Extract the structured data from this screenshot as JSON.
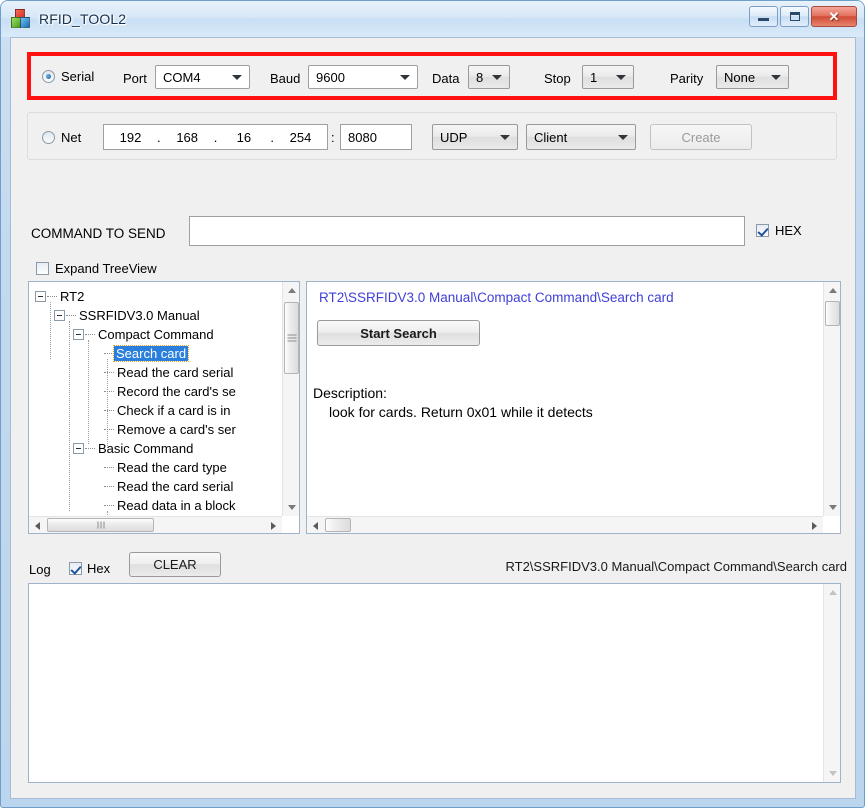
{
  "window": {
    "title": "RFID_TOOL2",
    "icon": "app-cubes-icon",
    "buttons": {
      "minimize": "minimize",
      "maximize": "maximize",
      "close": "close"
    }
  },
  "annotation": {
    "color": "#ff1111",
    "target": "serial-settings-row"
  },
  "serial": {
    "radio_label": "Serial",
    "radio_selected": true,
    "port_label": "Port",
    "port_value": "COM4",
    "baud_label": "Baud",
    "baud_value": "9600",
    "data_label": "Data",
    "data_value": "8",
    "stop_label": "Stop",
    "stop_value": "1",
    "parity_label": "Parity",
    "parity_value": "None"
  },
  "net": {
    "radio_label": "Net",
    "radio_selected": false,
    "ip_octets": [
      "192",
      "168",
      "16",
      "254"
    ],
    "separator": ".",
    "colon": ":",
    "port_value": "8080",
    "protocol_value": "UDP",
    "role_value": "Client",
    "create_label": "Create",
    "create_disabled": true
  },
  "command": {
    "label": "COMMAND TO SEND",
    "value": "",
    "placeholder": "",
    "hex_label": "HEX",
    "hex_checked": true
  },
  "expand_tree": {
    "label": "Expand TreeView",
    "checked": false
  },
  "tree": {
    "nodes": [
      {
        "label": "RT2",
        "depth": 0,
        "expander": true,
        "selected": false
      },
      {
        "label": "SSRFIDV3.0 Manual",
        "depth": 1,
        "expander": true,
        "selected": false
      },
      {
        "label": "Compact Command",
        "depth": 2,
        "expander": true,
        "selected": false
      },
      {
        "label": "Search card",
        "depth": 3,
        "expander": false,
        "selected": true
      },
      {
        "label": "Read the card serial",
        "depth": 3,
        "expander": false,
        "selected": false
      },
      {
        "label": "Record the card's se",
        "depth": 3,
        "expander": false,
        "selected": false
      },
      {
        "label": "Check if a card is in",
        "depth": 3,
        "expander": false,
        "selected": false
      },
      {
        "label": "Remove a card's ser",
        "depth": 3,
        "expander": false,
        "selected": false
      },
      {
        "label": "Basic Command",
        "depth": 2,
        "expander": true,
        "selected": false
      },
      {
        "label": "Read the card type",
        "depth": 3,
        "expander": false,
        "selected": false
      },
      {
        "label": "Read the card serial",
        "depth": 3,
        "expander": false,
        "selected": false
      },
      {
        "label": "Read data in a block",
        "depth": 3,
        "expander": false,
        "selected": false
      }
    ]
  },
  "detail": {
    "path": "RT2\\SSRFIDV3.0 Manual\\Compact Command\\Search card",
    "path_color": "#4040d8",
    "start_button": "Start Search",
    "description_title": "Description:",
    "description_body": "look for cards. Return 0x01 while it detects"
  },
  "log": {
    "label": "Log",
    "hex_label": "Hex",
    "hex_checked": true,
    "clear_label": "CLEAR",
    "status_path": "RT2\\SSRFIDV3.0 Manual\\Compact Command\\Search card",
    "content": ""
  }
}
